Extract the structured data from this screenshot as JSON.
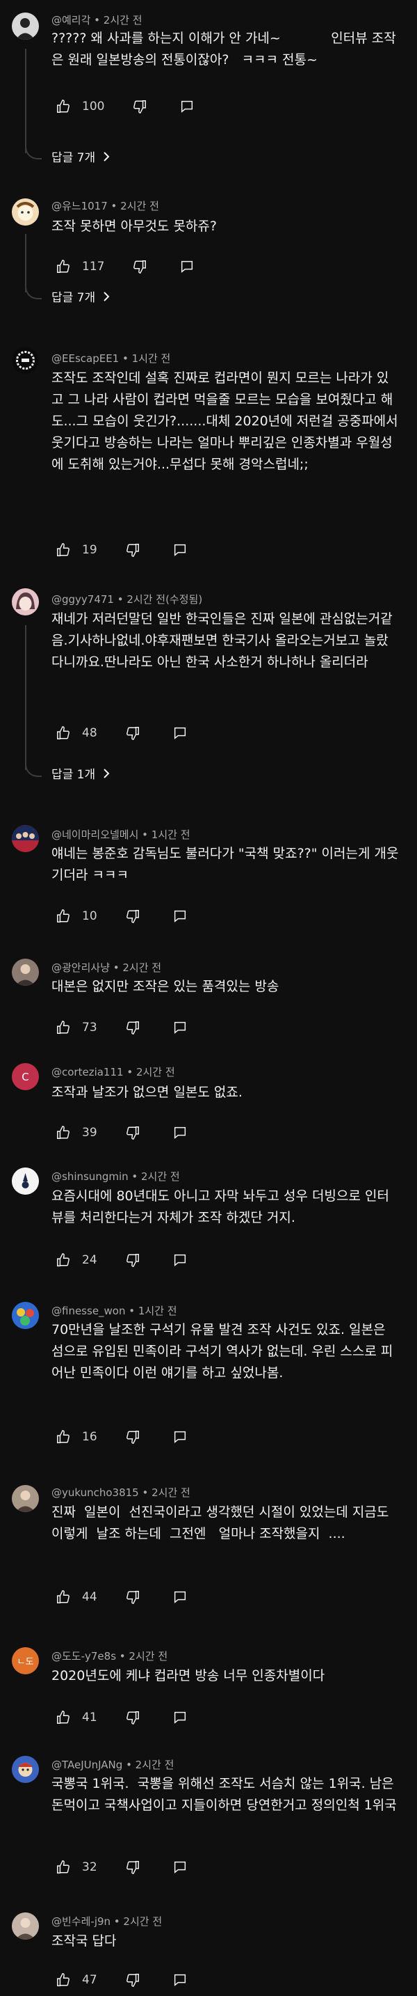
{
  "comments": [
    {
      "author": "@예리각",
      "meta": "@예리각 • 2시간 전",
      "text": "????? 왜 사과를 하는지 이해가 안 가네~            인터뷰 조작은 원래 일본방송의 전통이잖아?   ㅋㅋㅋ 전통~",
      "likes": "100",
      "replies": "답글 7개",
      "avatar_color": "#2b2b2b",
      "avatar_icon": "man-silhouette-icon"
    },
    {
      "author": "@유느1017",
      "meta": "@유느1017 • 2시간 전",
      "text": "조작 못하면 아무것도 못하쥬?",
      "likes": "117",
      "replies": "답글 7개",
      "avatar_color": "#e8cfa8",
      "avatar_icon": "cartoon-face-icon"
    },
    {
      "author": "@EEscapEE1",
      "meta": "@EEscapEE1 • 1시간 전",
      "text": "조작도 조작인데 설혹 진짜로 컵라면이 뭔지 모르는 나라가 있고 그 나라 사람이 컵라면 먹을줄 모르는 모습을 보여줬다고 해도...그 모습이 웃긴가?.......대체 2020년에 저런걸 공중파에서 웃기다고 방송하는 나라는 얼마나 뿌리깊은 인종차별과 우월성에 도취해 있는거야...무섭다 못해 경악스럽네;;",
      "likes": "19",
      "replies": "",
      "avatar_color": "#1a1a1a",
      "avatar_icon": "dotted-ring-logo-icon"
    },
    {
      "author": "@ggyy7471",
      "meta": "@ggyy7471 • 2시간 전(수정됨)",
      "text": "재네가 저러던말던 일반 한국인들은 진짜 일본에 관심없는거같음.기사하나없네.야후재팬보면 한국기사 올라오는거보고 놀랐다니까요.딴나라도 아닌 한국 사소한거 하나하나 올리더라",
      "likes": "48",
      "replies": "답글 1개",
      "avatar_color": "#d9b3b8",
      "avatar_icon": "anime-girl-icon"
    },
    {
      "author": "@네이마리오넬메시",
      "meta": "@네이마리오넬메시 • 1시간 전",
      "text": "얘네는 봉준호 감독님도 불러다가 \"국책 맞죠??\" 이러는게 개웃기더라 ㅋㅋㅋ",
      "likes": "10",
      "replies": "",
      "avatar_color": "#a6263a",
      "avatar_icon": "soccer-team-icon"
    },
    {
      "author": "@광안리사냥",
      "meta": "@광안리사냥 • 2시간 전",
      "text": "대본은 없지만 조작은 있는 품격있는 방송",
      "likes": "73",
      "replies": "",
      "avatar_color": "#7a6a6a",
      "avatar_icon": "photo-portrait-icon"
    },
    {
      "author": "@cortezia111",
      "meta": "@cortezia111 • 2시간 전",
      "text": "조작과 날조가 없으면 일본도 없죠.",
      "likes": "39",
      "replies": "",
      "avatar_color": "#c0304a",
      "avatar_letter": "C",
      "avatar_icon": "letter-avatar-icon"
    },
    {
      "author": "@shinsungmin",
      "meta": "@shinsungmin • 2시간 전",
      "text": "요즘시대에 80년대도 아니고 자막 놔두고 성우 더빙으로 인터뷰를 처리한다는거 자체가 조작 하겠단 거지.",
      "likes": "24",
      "replies": "",
      "avatar_color": "#f2f2f2",
      "avatar_icon": "spurs-crest-icon"
    },
    {
      "author": "@finesse_won",
      "meta": "@finesse_won • 1시간 전",
      "text": "70만년을 날조한 구석기 유물 발견 조작 사건도 있죠. 일본은 섬으로 유입된 민족이라 구석기 역사가 없는데. 우린 스스로 피어난 민족이다 이런 얘기를 하고 싶었나봄.",
      "likes": "16",
      "replies": "",
      "avatar_color": "#3a72c4",
      "avatar_icon": "colorful-logo-icon"
    },
    {
      "author": "@yukuncho3815",
      "meta": "@yukuncho3815 • 2시간 전",
      "text": "진짜  일본이  선진국이라고 생각했던 시절이 있었는데 지금도 이렇게  날조 하는데  그전엔   얼마나 조작했을지  ....",
      "likes": "44",
      "replies": "",
      "avatar_color": "#8a7a6e",
      "avatar_icon": "photo-portrait-icon"
    },
    {
      "author": "@도도-y7e8s",
      "meta": "@도도-y7e8s • 2시간 전",
      "text": "2020년도에 케냐 컵라면 방송 너무 인종차별이다",
      "likes": "41",
      "replies": "",
      "avatar_color": "#e0702a",
      "avatar_letter": "ㄴ도",
      "avatar_icon": "letter-avatar-icon"
    },
    {
      "author": "@TAeJUnJANg",
      "meta": "@TAeJUnJANg • 2시간 전",
      "text": "국뽕국 1위국.  국뽕을 위해선 조작도 서슴치 않는 1위국. 남은 돈먹이고 국책사업이고 지들이하면 당연한거고 정의인척 1위국",
      "likes": "32",
      "replies": "",
      "avatar_color": "#3b5fb8",
      "avatar_icon": "cartoon-character-icon"
    },
    {
      "author": "@빈수레-j9n",
      "meta": "@빈수레-j9n • 2시간 전",
      "text": "조작국 답다",
      "likes": "47",
      "replies": "",
      "avatar_color": "#b8a8a0",
      "avatar_icon": "photo-portrait-icon"
    }
  ],
  "icons": {
    "like": "thumbs-up-icon",
    "dislike": "thumbs-down-icon",
    "reply": "reply-bubble-icon",
    "expand": "chevron-right-icon"
  }
}
